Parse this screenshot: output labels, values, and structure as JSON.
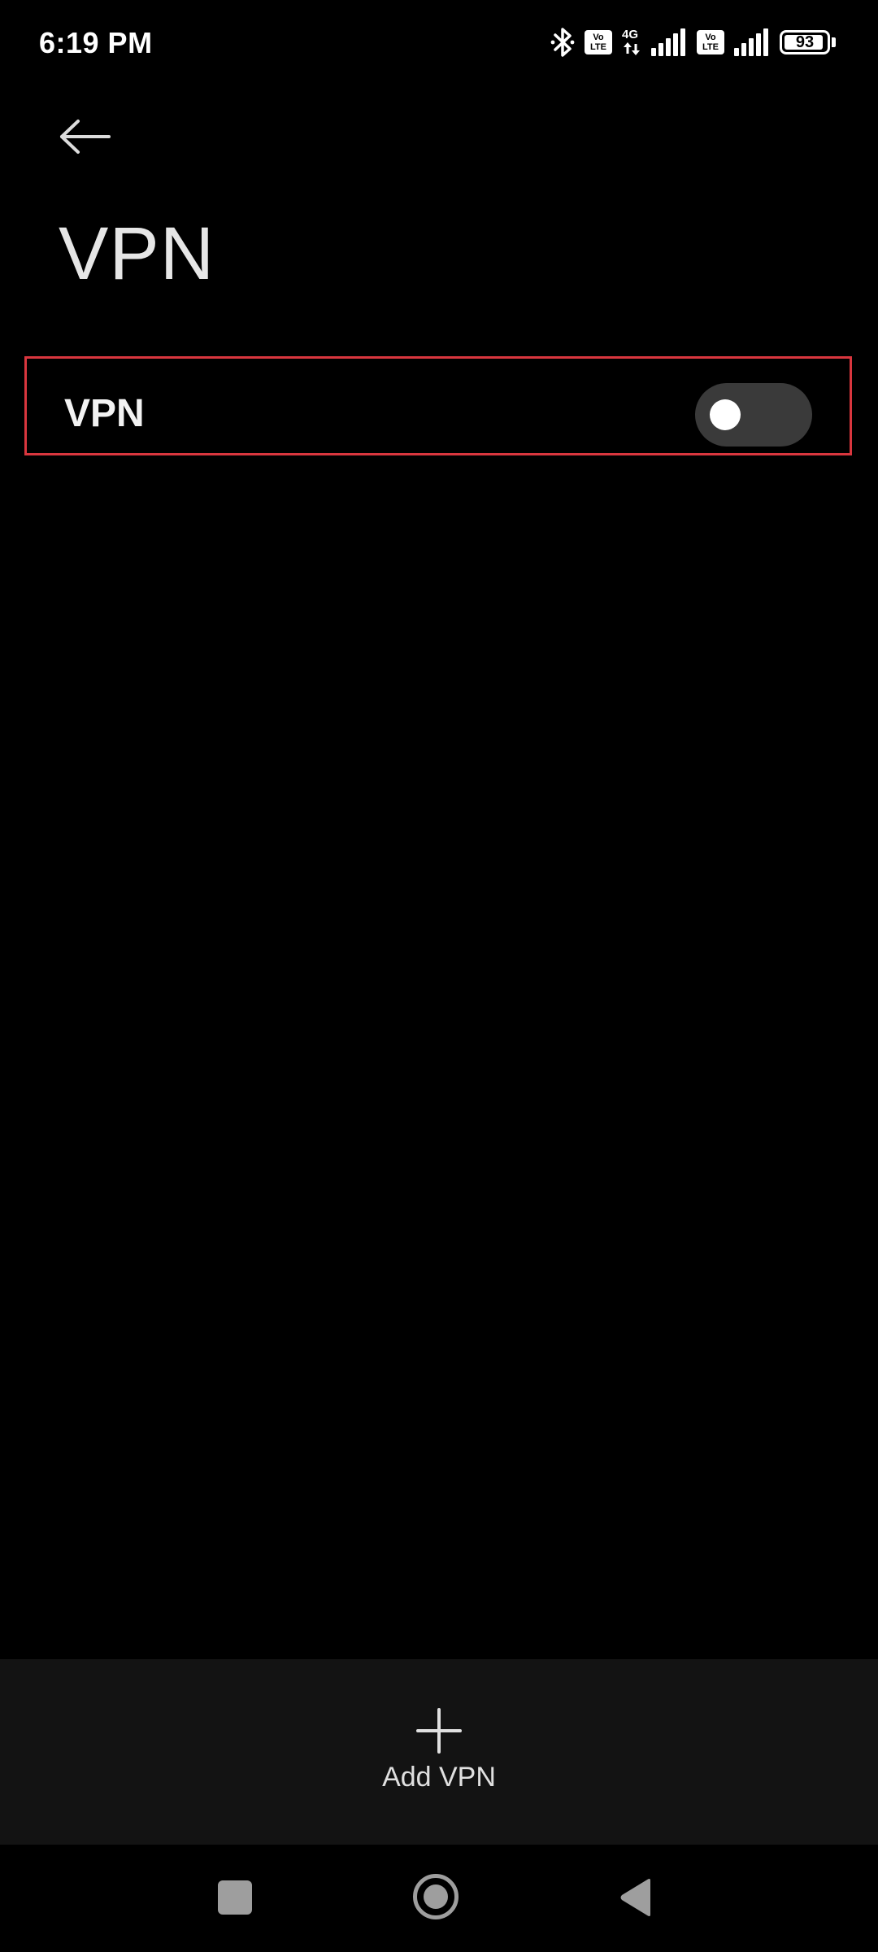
{
  "status_bar": {
    "time": "6:19 PM",
    "volte_1": {
      "top": "Vo",
      "bottom": "LTE"
    },
    "network_type": "4G",
    "volte_2": {
      "top": "Vo",
      "bottom": "LTE"
    },
    "battery_level": "93",
    "battery_fraction": 0.93,
    "icons": [
      "bluetooth-icon",
      "signal-bars-icon",
      "battery-icon"
    ]
  },
  "header": {
    "back_icon": "arrow-left-icon",
    "title": "VPN"
  },
  "vpn_row": {
    "label": "VPN",
    "toggle_on": false,
    "highlight_color": "#d9363e"
  },
  "bottom_bar": {
    "add_icon": "plus-icon",
    "add_label": "Add VPN"
  },
  "nav_bar": {
    "icons": [
      "recents-icon",
      "home-icon",
      "back-triangle-icon"
    ]
  },
  "colors": {
    "background": "#000000",
    "bottom_bar": "#131313",
    "toggle_track": "#3a3a3a",
    "nav_icon": "#9e9e9e"
  }
}
